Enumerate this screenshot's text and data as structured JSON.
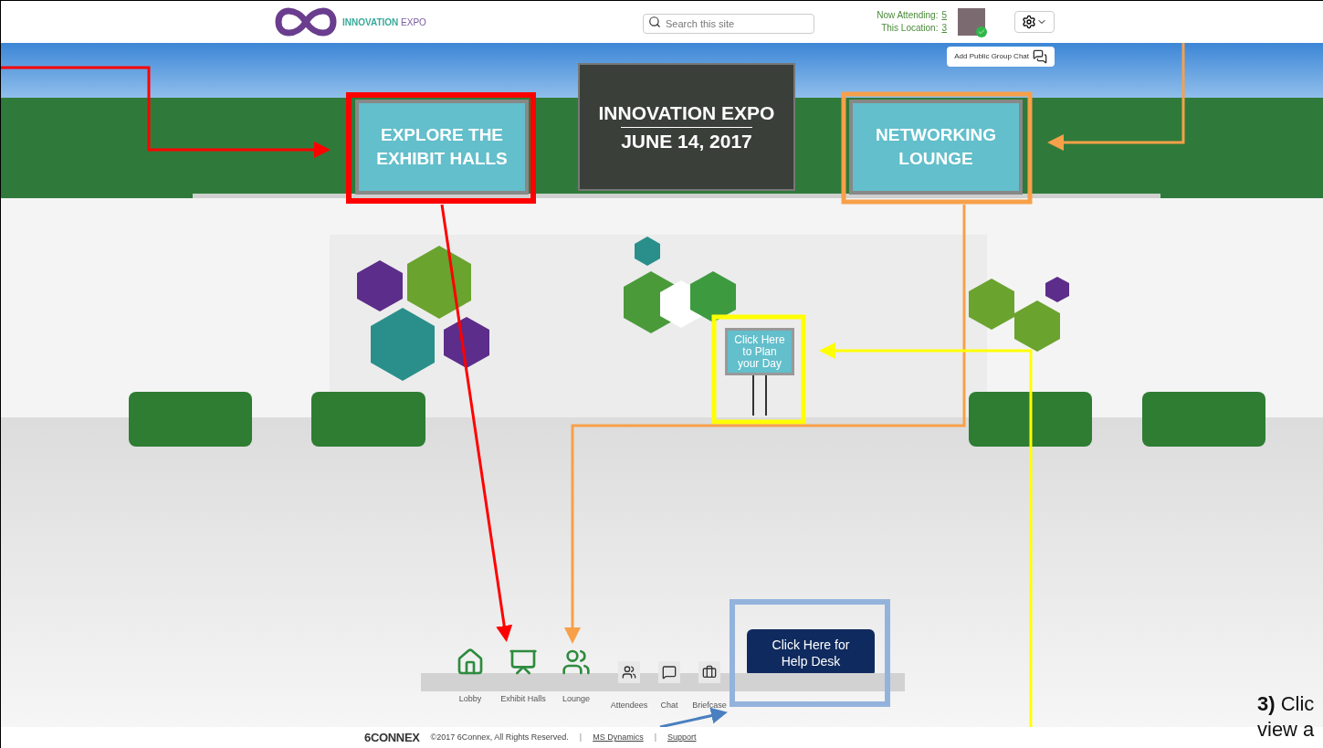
{
  "header": {
    "logo": {
      "brand": "INNOVATION",
      "suffix": "EXPO"
    },
    "search": {
      "placeholder": "Search this site"
    },
    "stats": [
      {
        "label": "Now Attending:",
        "value": "5"
      },
      {
        "label": "This Location:",
        "value": "3"
      }
    ],
    "user": {
      "online": true
    }
  },
  "group_chat_button": "Add Public Group Chat",
  "scene": {
    "banner": {
      "title": "INNOVATION EXPO",
      "date": "JUNE 14, 2017"
    },
    "signs": [
      {
        "kind": "exhibit",
        "lines": [
          "EXPLORE THE",
          "EXHIBIT HALLS"
        ]
      },
      {
        "kind": "lounge",
        "lines": [
          "NETWORKING",
          "LOUNGE"
        ]
      }
    ],
    "plan_sign": [
      "Click Here",
      "to Plan",
      "your Day"
    ],
    "help_desk_button": [
      "Click Here for",
      "Help Desk"
    ]
  },
  "nav": [
    {
      "kind": "lobby",
      "label": "Lobby"
    },
    {
      "kind": "exhibit",
      "label": "Exhibit Halls"
    },
    {
      "kind": "lounge",
      "label": "Lounge"
    },
    {
      "kind": "attendees",
      "label": "Attendees"
    },
    {
      "kind": "chat",
      "label": "Chat"
    },
    {
      "kind": "briefcase",
      "label": "Briefcase"
    }
  ],
  "footer": {
    "logo": "6CONNEX",
    "copyright": "©2017 6Connex, All Rights Reserved.",
    "links": [
      "MS Dynamics",
      "Support"
    ],
    "separators": [
      "|",
      "|"
    ]
  },
  "callout": [
    "**3)** Clic",
    "view a"
  ]
}
